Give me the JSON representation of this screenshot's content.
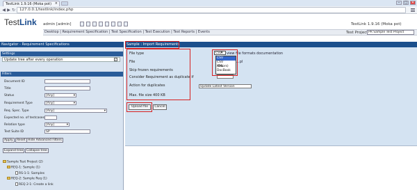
{
  "browser": {
    "tab_title": "TestLink 1.9.16 (Moka pot)",
    "url": "127.0.0.1/testlink/index.php",
    "window_controls": [
      "–",
      "□",
      "✕"
    ]
  },
  "header": {
    "logo_test": "Test",
    "logo_link": "Link",
    "user": "admin [admin]",
    "version": "TestLink 1.9.16 (Moka pot)",
    "links": "Desktop | Requirement Specification | Test Specification | Test Execution | Test Reports | Events",
    "project_label": "Test Project",
    "project_value": "PR Sample Test Project"
  },
  "left": {
    "title": "Navigator - Requirement Specifications",
    "settings_title": "Settings",
    "update_label": "Update tree after every operation",
    "update_checked": "✓",
    "filters_title": "Filters",
    "filters": [
      {
        "label": "Document ID",
        "value": ""
      },
      {
        "label": "Title",
        "value": ""
      },
      {
        "label": "Status",
        "value": "[Any]"
      },
      {
        "label": "Requirement Type",
        "value": "[Any]"
      },
      {
        "label": "Req. Spec. Type",
        "value": "[Any]"
      },
      {
        "label": "Expected no. of testcases",
        "value": ""
      },
      {
        "label": "Relation type",
        "value": "[Any]"
      },
      {
        "label": "Test Suite ID",
        "value": "SP"
      }
    ],
    "buttons": [
      "Apply",
      "Reset",
      "Hide Advanced Filters"
    ],
    "tree_buttons": [
      "Expand tree",
      "Collapse tree"
    ],
    "tree": [
      "Sample Test Project (2)",
      "REQ-1: Sample (1)",
      "RS-1-1: Samples",
      "REQ-2: Sample Req (1)",
      "REQ 2-1: Create a link"
    ]
  },
  "right": {
    "title": "Sample : Import Requirements",
    "file_type_label": "File type",
    "file_type_value": "CSV",
    "view_formats": "view file formats documentation",
    "file_label": "File",
    "file_value": "...pl",
    "skip_label": "Skip frozen requirements",
    "consider_label": "Consider Requirement as duplicate if",
    "action_label": "Action for duplicates",
    "action_value": "Update Latest Version",
    "max_size": "Max. file size 400 KB",
    "dropdown_options": [
      "CSV",
      "CSV (Doors)",
      "XML",
      "DocBook"
    ],
    "upload_label": "Upload file",
    "cancel_label": "Cancel"
  },
  "colors": {
    "title_bar": "#1b4f8c",
    "highlight": "#d61f1f",
    "pane_bg": "#d4e3f2",
    "selected_option": "#3366cc"
  }
}
